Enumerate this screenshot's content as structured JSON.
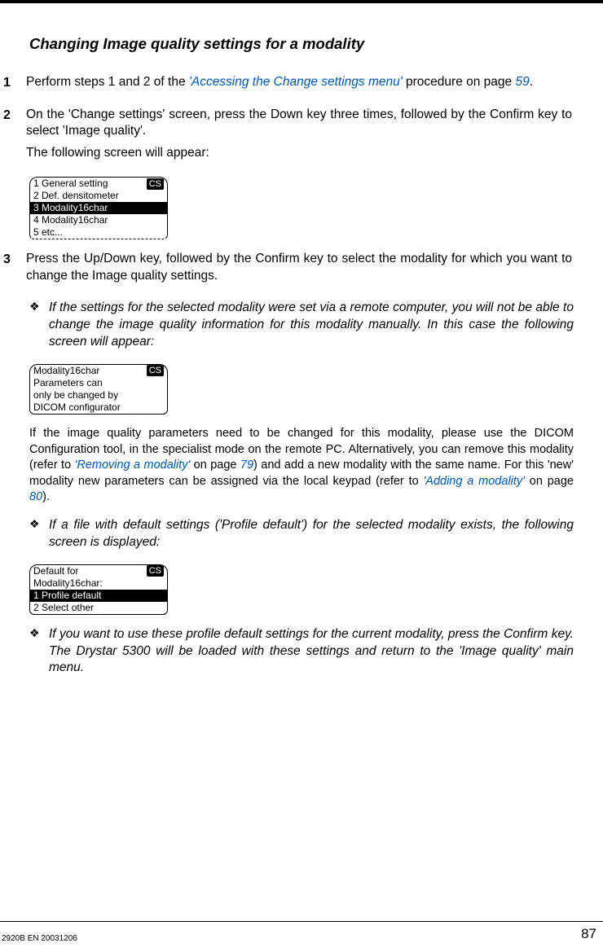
{
  "heading": "Changing Image quality settings for a modality",
  "steps": {
    "s1": {
      "num": "1",
      "pre": "Perform steps 1 and 2 of the ",
      "link": "'Accessing the Change settings menu'",
      "mid": " procedure on page ",
      "page": "59",
      "post": "."
    },
    "s2": {
      "num": "2",
      "line1": "On the 'Change settings' screen, press the Down key three times, followed by the Confirm key to select 'Image quality'.",
      "line2": "The following screen will appear:"
    },
    "s3": {
      "num": "3",
      "line1": "Press the Up/Down key, followed by the Confirm key to select the modality for which you want to change the Image quality settings."
    }
  },
  "screen1": {
    "badge": "CS",
    "r1": "1 General setting",
    "r2": "2 Def. densitometer",
    "r3": "3 Modality16char",
    "r4": "4 Modality16char",
    "r5": "5 etc..."
  },
  "note1": "If the settings for the selected modality were set via a remote computer, you will not be able to change the image quality information for this modality manually. In this case the following screen will appear:",
  "screen2": {
    "badge": "CS",
    "r1": "Modality16char",
    "r2": "Parameters can",
    "r3": "only be changed by",
    "r4": "DICOM configurator"
  },
  "para1": {
    "a": "If the image quality parameters need to be changed for this modality, please use the DICOM Configuration tool, in the specialist mode on the remote PC. Alternatively, you can remove this modality (refer to ",
    "link1": "'Removing a modality'",
    "b": " on page ",
    "p1": "79",
    "c": ") and add a new modality with the same name. For this 'new' modality new parameters can be assigned via the local keypad (refer to ",
    "link2": "'Adding a modality'",
    "d": " on page ",
    "p2": "80",
    "e": ")."
  },
  "note2": "If a file with default settings ('Profile default') for the selected modality exists, the following screen is displayed:",
  "screen3": {
    "badge": "CS",
    "r1": "Default for",
    "r2": "Modality16char:",
    "r3": "1 Profile default",
    "r4": "2 Select other"
  },
  "note3": "If you want to use these profile default settings for the current modality, press the Confirm key. The Drystar 5300 will be loaded with these settings and return to the 'Image quality' main menu.",
  "footer": {
    "docid": "2920B EN 20031206",
    "page": "87"
  },
  "bullet": "❖"
}
